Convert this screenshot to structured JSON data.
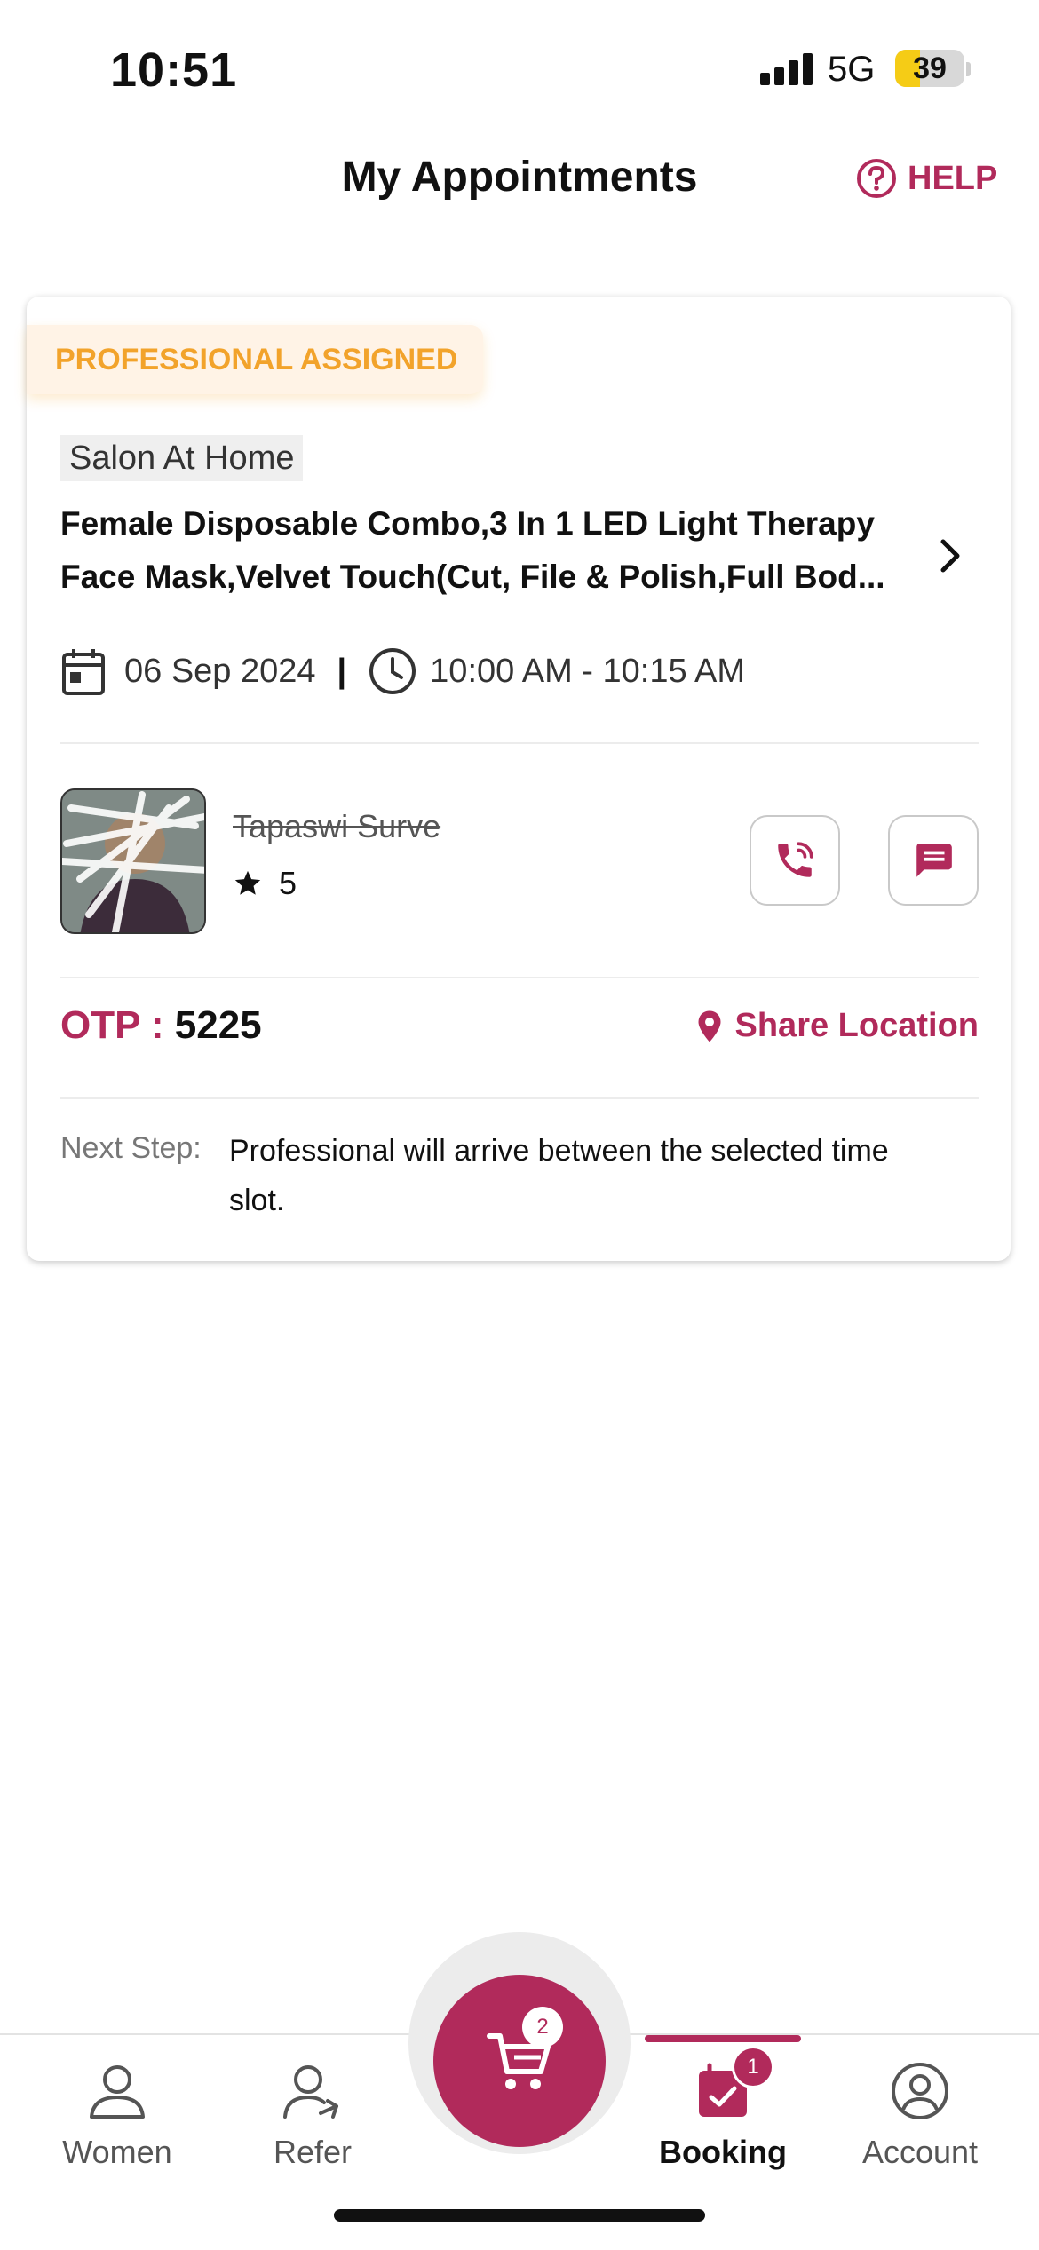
{
  "status_bar": {
    "time": "10:51",
    "network": "5G",
    "battery": "39",
    "battery_level": 0.39
  },
  "header": {
    "title": "My Appointments",
    "help_label": "HELP",
    "help_icon": "question-circle-icon"
  },
  "appointment": {
    "status": "PROFESSIONAL ASSIGNED",
    "category": "Salon At Home",
    "services_line1": "Female Disposable Combo,3 In 1 LED Light Therapy",
    "services_line2": "Face Mask,Velvet Touch(Cut, File & Polish,Full Bod...",
    "date": "06 Sep 2024",
    "separator": "|",
    "time": "10:00 AM - 10:15 AM",
    "professional": {
      "name": "Tapaswi Surve",
      "rating": "5"
    },
    "otp_label": "OTP :",
    "otp_value": "5225",
    "share_location_label": "Share Location",
    "next_step_label": "Next Step:",
    "next_step_text": "Professional will arrive between the selected time slot."
  },
  "bottom_nav": {
    "items": [
      {
        "label": "Women",
        "icon": "person-icon"
      },
      {
        "label": "Refer",
        "icon": "refer-icon"
      },
      {
        "label": "Booking",
        "icon": "calendar-check-icon",
        "badge": "1",
        "active": true
      },
      {
        "label": "Account",
        "icon": "account-circle-icon"
      }
    ],
    "cart_badge": "2"
  },
  "colors": {
    "brand": "#b12a5b",
    "badge_orange": "#f2a32b",
    "badge_bg": "#fff3e6"
  }
}
